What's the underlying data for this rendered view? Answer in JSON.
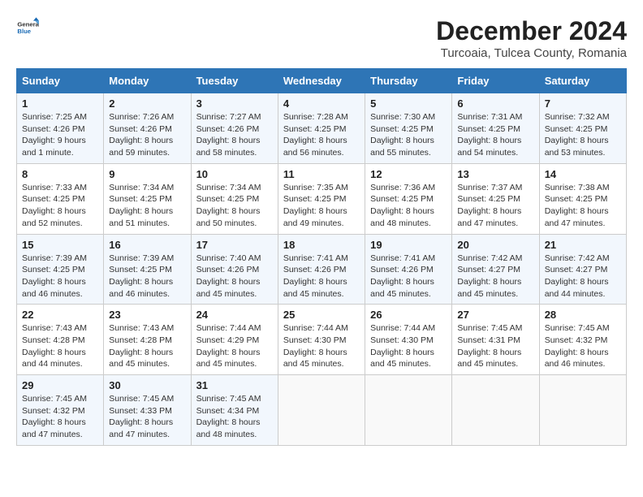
{
  "logo": {
    "general": "General",
    "blue": "Blue"
  },
  "header": {
    "month": "December 2024",
    "location": "Turcoaia, Tulcea County, Romania"
  },
  "weekdays": [
    "Sunday",
    "Monday",
    "Tuesday",
    "Wednesday",
    "Thursday",
    "Friday",
    "Saturday"
  ],
  "weeks": [
    [
      {
        "day": "1",
        "sunrise": "Sunrise: 7:25 AM",
        "sunset": "Sunset: 4:26 PM",
        "daylight": "Daylight: 9 hours and 1 minute."
      },
      {
        "day": "2",
        "sunrise": "Sunrise: 7:26 AM",
        "sunset": "Sunset: 4:26 PM",
        "daylight": "Daylight: 8 hours and 59 minutes."
      },
      {
        "day": "3",
        "sunrise": "Sunrise: 7:27 AM",
        "sunset": "Sunset: 4:26 PM",
        "daylight": "Daylight: 8 hours and 58 minutes."
      },
      {
        "day": "4",
        "sunrise": "Sunrise: 7:28 AM",
        "sunset": "Sunset: 4:25 PM",
        "daylight": "Daylight: 8 hours and 56 minutes."
      },
      {
        "day": "5",
        "sunrise": "Sunrise: 7:30 AM",
        "sunset": "Sunset: 4:25 PM",
        "daylight": "Daylight: 8 hours and 55 minutes."
      },
      {
        "day": "6",
        "sunrise": "Sunrise: 7:31 AM",
        "sunset": "Sunset: 4:25 PM",
        "daylight": "Daylight: 8 hours and 54 minutes."
      },
      {
        "day": "7",
        "sunrise": "Sunrise: 7:32 AM",
        "sunset": "Sunset: 4:25 PM",
        "daylight": "Daylight: 8 hours and 53 minutes."
      }
    ],
    [
      {
        "day": "8",
        "sunrise": "Sunrise: 7:33 AM",
        "sunset": "Sunset: 4:25 PM",
        "daylight": "Daylight: 8 hours and 52 minutes."
      },
      {
        "day": "9",
        "sunrise": "Sunrise: 7:34 AM",
        "sunset": "Sunset: 4:25 PM",
        "daylight": "Daylight: 8 hours and 51 minutes."
      },
      {
        "day": "10",
        "sunrise": "Sunrise: 7:34 AM",
        "sunset": "Sunset: 4:25 PM",
        "daylight": "Daylight: 8 hours and 50 minutes."
      },
      {
        "day": "11",
        "sunrise": "Sunrise: 7:35 AM",
        "sunset": "Sunset: 4:25 PM",
        "daylight": "Daylight: 8 hours and 49 minutes."
      },
      {
        "day": "12",
        "sunrise": "Sunrise: 7:36 AM",
        "sunset": "Sunset: 4:25 PM",
        "daylight": "Daylight: 8 hours and 48 minutes."
      },
      {
        "day": "13",
        "sunrise": "Sunrise: 7:37 AM",
        "sunset": "Sunset: 4:25 PM",
        "daylight": "Daylight: 8 hours and 47 minutes."
      },
      {
        "day": "14",
        "sunrise": "Sunrise: 7:38 AM",
        "sunset": "Sunset: 4:25 PM",
        "daylight": "Daylight: 8 hours and 47 minutes."
      }
    ],
    [
      {
        "day": "15",
        "sunrise": "Sunrise: 7:39 AM",
        "sunset": "Sunset: 4:25 PM",
        "daylight": "Daylight: 8 hours and 46 minutes."
      },
      {
        "day": "16",
        "sunrise": "Sunrise: 7:39 AM",
        "sunset": "Sunset: 4:25 PM",
        "daylight": "Daylight: 8 hours and 46 minutes."
      },
      {
        "day": "17",
        "sunrise": "Sunrise: 7:40 AM",
        "sunset": "Sunset: 4:26 PM",
        "daylight": "Daylight: 8 hours and 45 minutes."
      },
      {
        "day": "18",
        "sunrise": "Sunrise: 7:41 AM",
        "sunset": "Sunset: 4:26 PM",
        "daylight": "Daylight: 8 hours and 45 minutes."
      },
      {
        "day": "19",
        "sunrise": "Sunrise: 7:41 AM",
        "sunset": "Sunset: 4:26 PM",
        "daylight": "Daylight: 8 hours and 45 minutes."
      },
      {
        "day": "20",
        "sunrise": "Sunrise: 7:42 AM",
        "sunset": "Sunset: 4:27 PM",
        "daylight": "Daylight: 8 hours and 45 minutes."
      },
      {
        "day": "21",
        "sunrise": "Sunrise: 7:42 AM",
        "sunset": "Sunset: 4:27 PM",
        "daylight": "Daylight: 8 hours and 44 minutes."
      }
    ],
    [
      {
        "day": "22",
        "sunrise": "Sunrise: 7:43 AM",
        "sunset": "Sunset: 4:28 PM",
        "daylight": "Daylight: 8 hours and 44 minutes."
      },
      {
        "day": "23",
        "sunrise": "Sunrise: 7:43 AM",
        "sunset": "Sunset: 4:28 PM",
        "daylight": "Daylight: 8 hours and 45 minutes."
      },
      {
        "day": "24",
        "sunrise": "Sunrise: 7:44 AM",
        "sunset": "Sunset: 4:29 PM",
        "daylight": "Daylight: 8 hours and 45 minutes."
      },
      {
        "day": "25",
        "sunrise": "Sunrise: 7:44 AM",
        "sunset": "Sunset: 4:30 PM",
        "daylight": "Daylight: 8 hours and 45 minutes."
      },
      {
        "day": "26",
        "sunrise": "Sunrise: 7:44 AM",
        "sunset": "Sunset: 4:30 PM",
        "daylight": "Daylight: 8 hours and 45 minutes."
      },
      {
        "day": "27",
        "sunrise": "Sunrise: 7:45 AM",
        "sunset": "Sunset: 4:31 PM",
        "daylight": "Daylight: 8 hours and 45 minutes."
      },
      {
        "day": "28",
        "sunrise": "Sunrise: 7:45 AM",
        "sunset": "Sunset: 4:32 PM",
        "daylight": "Daylight: 8 hours and 46 minutes."
      }
    ],
    [
      {
        "day": "29",
        "sunrise": "Sunrise: 7:45 AM",
        "sunset": "Sunset: 4:32 PM",
        "daylight": "Daylight: 8 hours and 47 minutes."
      },
      {
        "day": "30",
        "sunrise": "Sunrise: 7:45 AM",
        "sunset": "Sunset: 4:33 PM",
        "daylight": "Daylight: 8 hours and 47 minutes."
      },
      {
        "day": "31",
        "sunrise": "Sunrise: 7:45 AM",
        "sunset": "Sunset: 4:34 PM",
        "daylight": "Daylight: 8 hours and 48 minutes."
      },
      null,
      null,
      null,
      null
    ]
  ]
}
